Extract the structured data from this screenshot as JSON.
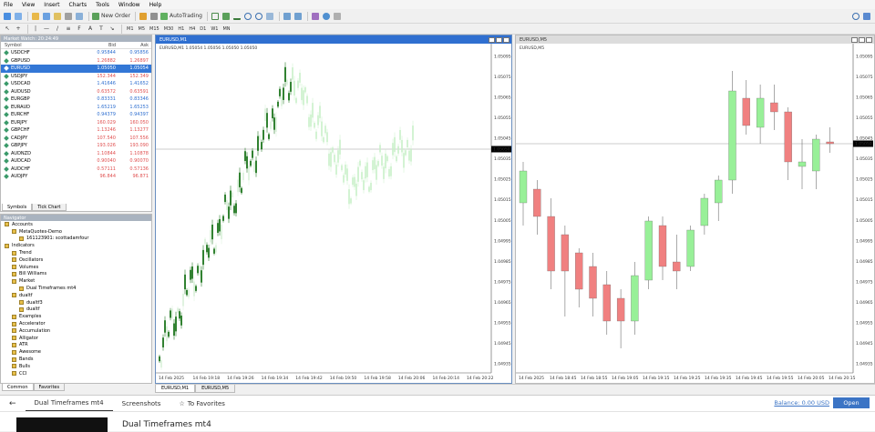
{
  "menu": [
    "File",
    "View",
    "Insert",
    "Charts",
    "Tools",
    "Window",
    "Help"
  ],
  "toolbar": {
    "new_order": "New Order",
    "autotrading": "AutoTrading",
    "timeframes": [
      "M1",
      "M5",
      "M15",
      "M30",
      "H1",
      "H4",
      "D1",
      "W1",
      "MN"
    ]
  },
  "market_watch": {
    "title": "Market Watch: 20:24:49",
    "columns": [
      "Symbol",
      "Bid",
      "Ask"
    ],
    "rows": [
      {
        "symbol": "USDCHF",
        "bid": "0.95844",
        "ask": "0.95856",
        "color": "#2f6fd0"
      },
      {
        "symbol": "GBPUSD",
        "bid": "1.26882",
        "ask": "1.26897",
        "color": "#e05050"
      },
      {
        "symbol": "EURUSD",
        "bid": "1.05050",
        "ask": "1.05054",
        "color": "#ffffff",
        "selected": true
      },
      {
        "symbol": "USDJPY",
        "bid": "152.344",
        "ask": "152.349",
        "color": "#e05050"
      },
      {
        "symbol": "USDCAD",
        "bid": "1.41646",
        "ask": "1.41652",
        "color": "#2f6fd0"
      },
      {
        "symbol": "AUDUSD",
        "bid": "0.63572",
        "ask": "0.63591",
        "color": "#e05050"
      },
      {
        "symbol": "EURGBP",
        "bid": "0.83331",
        "ask": "0.83346",
        "color": "#2f6fd0"
      },
      {
        "symbol": "EURAUD",
        "bid": "1.65219",
        "ask": "1.65253",
        "color": "#2f6fd0"
      },
      {
        "symbol": "EURCHF",
        "bid": "0.94379",
        "ask": "0.94397",
        "color": "#2f6fd0"
      },
      {
        "symbol": "EURJPY",
        "bid": "160.029",
        "ask": "160.050",
        "color": "#e05050"
      },
      {
        "symbol": "GBPCHF",
        "bid": "1.13246",
        "ask": "1.13277",
        "color": "#e05050"
      },
      {
        "symbol": "CADJPY",
        "bid": "107.540",
        "ask": "107.556",
        "color": "#e05050"
      },
      {
        "symbol": "GBPJPY",
        "bid": "193.026",
        "ask": "193.090",
        "color": "#e05050"
      },
      {
        "symbol": "AUDNZD",
        "bid": "1.10844",
        "ask": "1.10878",
        "color": "#e05050"
      },
      {
        "symbol": "AUDCAD",
        "bid": "0.90040",
        "ask": "0.90070",
        "color": "#e05050"
      },
      {
        "symbol": "AUDCHF",
        "bid": "0.57111",
        "ask": "0.57136",
        "color": "#e05050"
      },
      {
        "symbol": "AUDJPY",
        "bid": "96.844",
        "ask": "96.871",
        "color": "#e05050"
      }
    ],
    "tabs": [
      "Symbols",
      "Tick Chart"
    ]
  },
  "navigator": {
    "title": "Navigator",
    "items": [
      {
        "label": "Accounts",
        "indent": 0
      },
      {
        "label": "MetaQuotes-Demo",
        "indent": 1
      },
      {
        "label": "161123901: scottadamfour",
        "indent": 2
      },
      {
        "label": "Indicators",
        "indent": 0
      },
      {
        "label": "Trend",
        "indent": 1
      },
      {
        "label": "Oscillators",
        "indent": 1
      },
      {
        "label": "Volumes",
        "indent": 1
      },
      {
        "label": "Bill Williams",
        "indent": 1
      },
      {
        "label": "Market",
        "indent": 1
      },
      {
        "label": "Dual Timeframes mt4",
        "indent": 2
      },
      {
        "label": "dualtf",
        "indent": 1
      },
      {
        "label": "dualtf3",
        "indent": 2
      },
      {
        "label": "dualtf",
        "indent": 2
      },
      {
        "label": "Examples",
        "indent": 1
      },
      {
        "label": "Accelerator",
        "indent": 1
      },
      {
        "label": "Accumulation",
        "indent": 1
      },
      {
        "label": "Alligator",
        "indent": 1
      },
      {
        "label": "ATR",
        "indent": 1
      },
      {
        "label": "Awesome",
        "indent": 1
      },
      {
        "label": "Bands",
        "indent": 1
      },
      {
        "label": "Bulls",
        "indent": 1
      },
      {
        "label": "CCI",
        "indent": 1
      }
    ],
    "tabs": [
      "Common",
      "Favorites"
    ]
  },
  "chart_m1": {
    "window_title": "EURUSD,M1",
    "label": "EURUSD,M1  1.05054 1.05056 1.05050 1.05050",
    "current_price": "1.05050",
    "price_ticks": [
      "1.05095",
      "1.05075",
      "1.05065",
      "1.05055",
      "1.05045",
      "1.05035",
      "1.05025",
      "1.05015",
      "1.05005",
      "1.04995",
      "1.04985",
      "1.04975",
      "1.04965",
      "1.04955",
      "1.04945",
      "1.04935"
    ],
    "time_ticks": [
      "14 Feb 2025",
      "14 Feb 19:18",
      "14 Feb 19:26",
      "14 Feb 19:34",
      "14 Feb 19:42",
      "14 Feb 19:50",
      "14 Feb 19:58",
      "14 Feb 20:06",
      "14 Feb 20:14",
      "14 Feb 20:22"
    ]
  },
  "chart_m5": {
    "window_title": "EURUSD,M5",
    "label": "EURUSD,M5",
    "current_price": "1.05050",
    "price_ticks": [
      "1.05095",
      "1.05075",
      "1.05065",
      "1.05055",
      "1.05045",
      "1.05035",
      "1.05025",
      "1.05015",
      "1.05005",
      "1.04995",
      "1.04985",
      "1.04975",
      "1.04965",
      "1.04955",
      "1.04945",
      "1.04935"
    ],
    "time_ticks": [
      "14 Feb 2025",
      "14 Feb 18:45",
      "14 Feb 18:55",
      "14 Feb 19:05",
      "14 Feb 19:15",
      "14 Feb 19:25",
      "14 Feb 19:35",
      "14 Feb 19:45",
      "14 Feb 19:55",
      "14 Feb 20:05",
      "14 Feb 20:15"
    ]
  },
  "chart_tabs": [
    "EURUSD,M1",
    "EURUSD,M5"
  ],
  "info_bar": {
    "tabs": [
      "Dual Timeframes mt4",
      "Screenshots",
      "To Favorites"
    ],
    "balance": "Balance: 0.00 USD",
    "open": "Open"
  },
  "product": {
    "title": "Dual Timeframes mt4"
  },
  "colors": {
    "bull": "#98f098",
    "bear": "#f08080",
    "m1_bull": "#006400",
    "m1_ghost": "#c8f0c8",
    "window_title": "#2f6fd0",
    "inactive_title": "#dcdcdc"
  }
}
